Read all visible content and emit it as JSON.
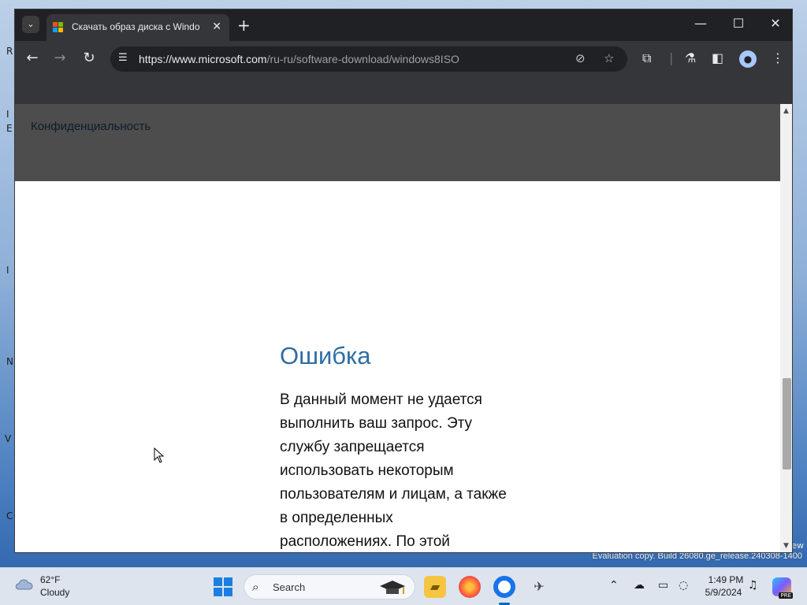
{
  "browser": {
    "tab_title": "Скачать образ диска с Windo",
    "tab_search_icon": "chevron-down-icon",
    "new_tab_symbol": "+",
    "close_symbol": "✕",
    "url_host": "https://www.microsoft.com",
    "url_path": "/ru-ru/software-download/windows8ISO",
    "window_controls": {
      "minimize": "—",
      "maximize": "☐",
      "close": "✕"
    }
  },
  "page": {
    "privacy_link": "Конфиденциальность",
    "error_title": "Ошибка",
    "error_lines": [
      "В данный момент не удается",
      "выполнить ваш запрос. Эту",
      "службу запрещается",
      "использовать некоторым",
      "пользователям и лицам, а также",
      "в определенных",
      "расположениях. По этой"
    ]
  },
  "desktop": {
    "watermark": "Evaluation copy. Build 26080.ge_release.240308-1400",
    "watermark_ghost": "ew",
    "fragments": [
      "R",
      "I",
      "E",
      "I",
      "N",
      "V",
      "C"
    ]
  },
  "taskbar": {
    "weather_temp": "62°F",
    "weather_desc": "Cloudy",
    "search_label": "Search",
    "clock_time": "1:49 PM",
    "clock_date": "5/9/2024",
    "copilot_badge": "PRE"
  },
  "colors": {
    "accent": "#2e6da4",
    "browser_bg": "#202124",
    "toolbar_bg": "#35363a",
    "overlay": "#4d4d4d",
    "taskbar_bg": "#dde4ee"
  }
}
